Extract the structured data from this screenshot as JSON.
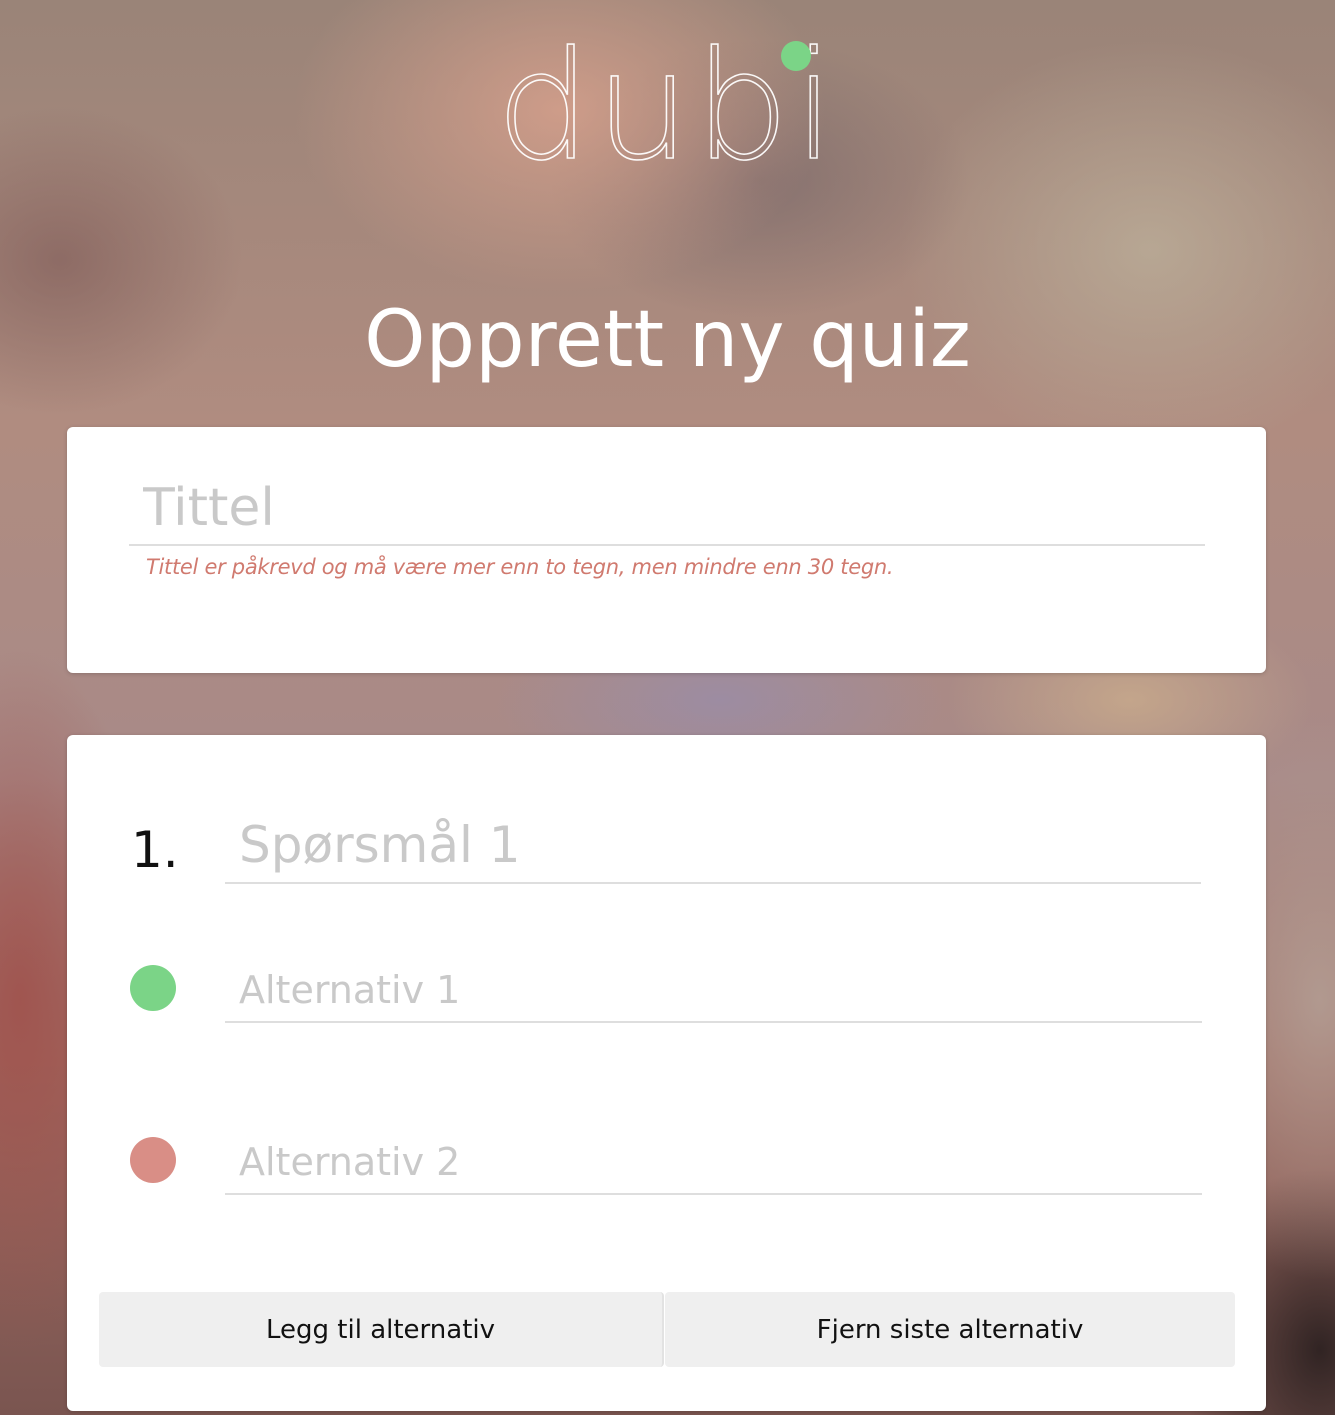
{
  "logo": {
    "text": "dubi",
    "dot_color": "#7bd487"
  },
  "page": {
    "title": "Opprett ny quiz"
  },
  "title_card": {
    "placeholder": "Tittel",
    "value": "",
    "error": "Tittel er påkrevd og må være mer enn to tegn, men mindre enn 30 tegn."
  },
  "question": {
    "number": "1.",
    "placeholder": "Spørsmål 1",
    "alternatives": [
      {
        "placeholder": "Alternativ 1",
        "indicator_color": "#7bd487",
        "correct": true
      },
      {
        "placeholder": "Alternativ 2",
        "indicator_color": "#d98e86",
        "correct": false
      }
    ],
    "add_alternative_label": "Legg til alternativ",
    "remove_alternative_label": "Fjern siste alternativ"
  }
}
